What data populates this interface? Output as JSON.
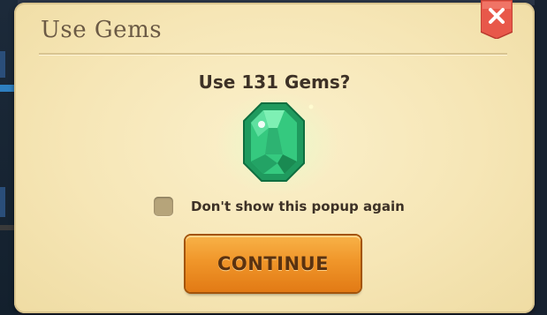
{
  "popup": {
    "title": "Use Gems",
    "question": "Use 131 Gems?",
    "checkbox_label": "Don't show this popup again",
    "checkbox_checked": false,
    "continue_label": "CONTINUE"
  },
  "icons": {
    "close": "close-icon",
    "gem": "gem-icon"
  },
  "colors": {
    "panel": "#f6e6b6",
    "button": "#f0962a",
    "close": "#e8584a",
    "gem": "#2fbf7a"
  }
}
